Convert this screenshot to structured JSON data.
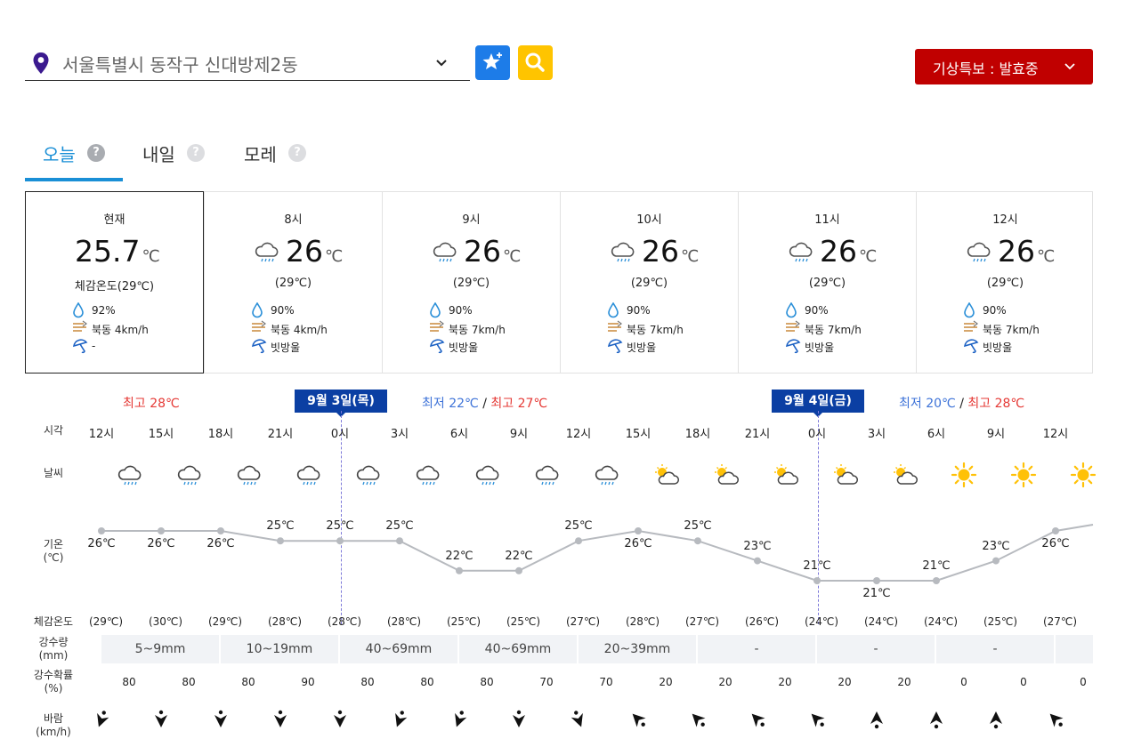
{
  "location": {
    "text": "서울특별시 동작구 신대방제2동"
  },
  "alert": {
    "label": "기상특보 : 발효중"
  },
  "tabs": [
    {
      "label": "오늘",
      "help": "?"
    },
    {
      "label": "내일",
      "help": "?"
    },
    {
      "label": "모레",
      "help": "?"
    }
  ],
  "cards": [
    {
      "time": "현재",
      "temp": "25.7",
      "unit": "℃",
      "feel": "체감온도(29℃)",
      "humidity": "92%",
      "wind": "북동 4km/h",
      "rain": "-",
      "icon": "none"
    },
    {
      "time": "8시",
      "temp": "26",
      "unit": "℃",
      "feel": "(29℃)",
      "humidity": "90%",
      "wind": "북동 4km/h",
      "rain": "빗방울",
      "icon": "rain-cloud-icon"
    },
    {
      "time": "9시",
      "temp": "26",
      "unit": "℃",
      "feel": "(29℃)",
      "humidity": "90%",
      "wind": "북동 7km/h",
      "rain": "빗방울",
      "icon": "rain-cloud-icon"
    },
    {
      "time": "10시",
      "temp": "26",
      "unit": "℃",
      "feel": "(29℃)",
      "humidity": "90%",
      "wind": "북동 7km/h",
      "rain": "빗방울",
      "icon": "rain-cloud-icon"
    },
    {
      "time": "11시",
      "temp": "26",
      "unit": "℃",
      "feel": "(29℃)",
      "humidity": "90%",
      "wind": "북동 7km/h",
      "rain": "빗방울",
      "icon": "rain-cloud-icon"
    },
    {
      "time": "12시",
      "temp": "26",
      "unit": "℃",
      "feel": "(29℃)",
      "humidity": "90%",
      "wind": "북동 7km/h",
      "rain": "빗방울",
      "icon": "rain-cloud-icon"
    }
  ],
  "day_headers": {
    "today_range": {
      "hi": "최고 28℃"
    },
    "day1": {
      "label": "9월 3일(목)",
      "lo": "최저 22℃",
      "sep": "/",
      "hi": "최고 27℃"
    },
    "day2": {
      "label": "9월 4일(금)",
      "lo": "최저 20℃",
      "sep": "/",
      "hi": "최고 28℃"
    }
  },
  "row_labels": {
    "time": "시각",
    "weather": "날씨",
    "temp": [
      "기온",
      "(℃)"
    ],
    "feel": "체감온도",
    "precip": [
      "강수량",
      "(mm)"
    ],
    "prob": [
      "강수확률",
      "(%)"
    ],
    "wind": [
      "바람",
      "(km/h)"
    ]
  },
  "timeline": {
    "hours": [
      "12시",
      "15시",
      "18시",
      "21시",
      "0시",
      "3시",
      "6시",
      "9시",
      "12시",
      "15시",
      "18시",
      "21시",
      "0시",
      "3시",
      "6시",
      "9시",
      "12시"
    ],
    "icons": [
      "rain",
      "rain",
      "rain",
      "rain",
      "rain",
      "rain",
      "rain",
      "rain",
      "rain",
      "partly-cloudy",
      "partly-cloudy",
      "partly-cloudy",
      "partly-cloudy",
      "partly-cloudy",
      "sunny",
      "sunny",
      "sunny"
    ],
    "temps": [
      "26℃",
      "26℃",
      "26℃",
      "25℃",
      "25℃",
      "25℃",
      "22℃",
      "22℃",
      "25℃",
      "26℃",
      "25℃",
      "23℃",
      "21℃",
      "21℃",
      "21℃",
      "23℃",
      "26℃"
    ],
    "temp_values": [
      26,
      26,
      26,
      25,
      25,
      25,
      22,
      22,
      25,
      26,
      25,
      23,
      21,
      21,
      21,
      23,
      26
    ],
    "feels": [
      "(29℃)",
      "(30℃)",
      "(29℃)",
      "(28℃)",
      "(28℃)",
      "(28℃)",
      "(25℃)",
      "(25℃)",
      "(27℃)",
      "(28℃)",
      "(27℃)",
      "(26℃)",
      "(24℃)",
      "(24℃)",
      "(24℃)",
      "(25℃)",
      "(27℃)"
    ],
    "precip": [
      "5~9mm",
      "10~19mm",
      "40~69mm",
      "40~69mm",
      "20~39mm",
      "-",
      "-",
      "-",
      ""
    ],
    "prob": [
      "80",
      "80",
      "80",
      "90",
      "80",
      "80",
      "80",
      "70",
      "70",
      "20",
      "20",
      "20",
      "20",
      "20",
      "0",
      "0",
      "0"
    ]
  },
  "colors": {
    "accent": "#1a8fd6",
    "alert": "#c00000",
    "date_label": "#0b3fa3",
    "hi": "#e53935",
    "lo": "#3e73d8"
  }
}
